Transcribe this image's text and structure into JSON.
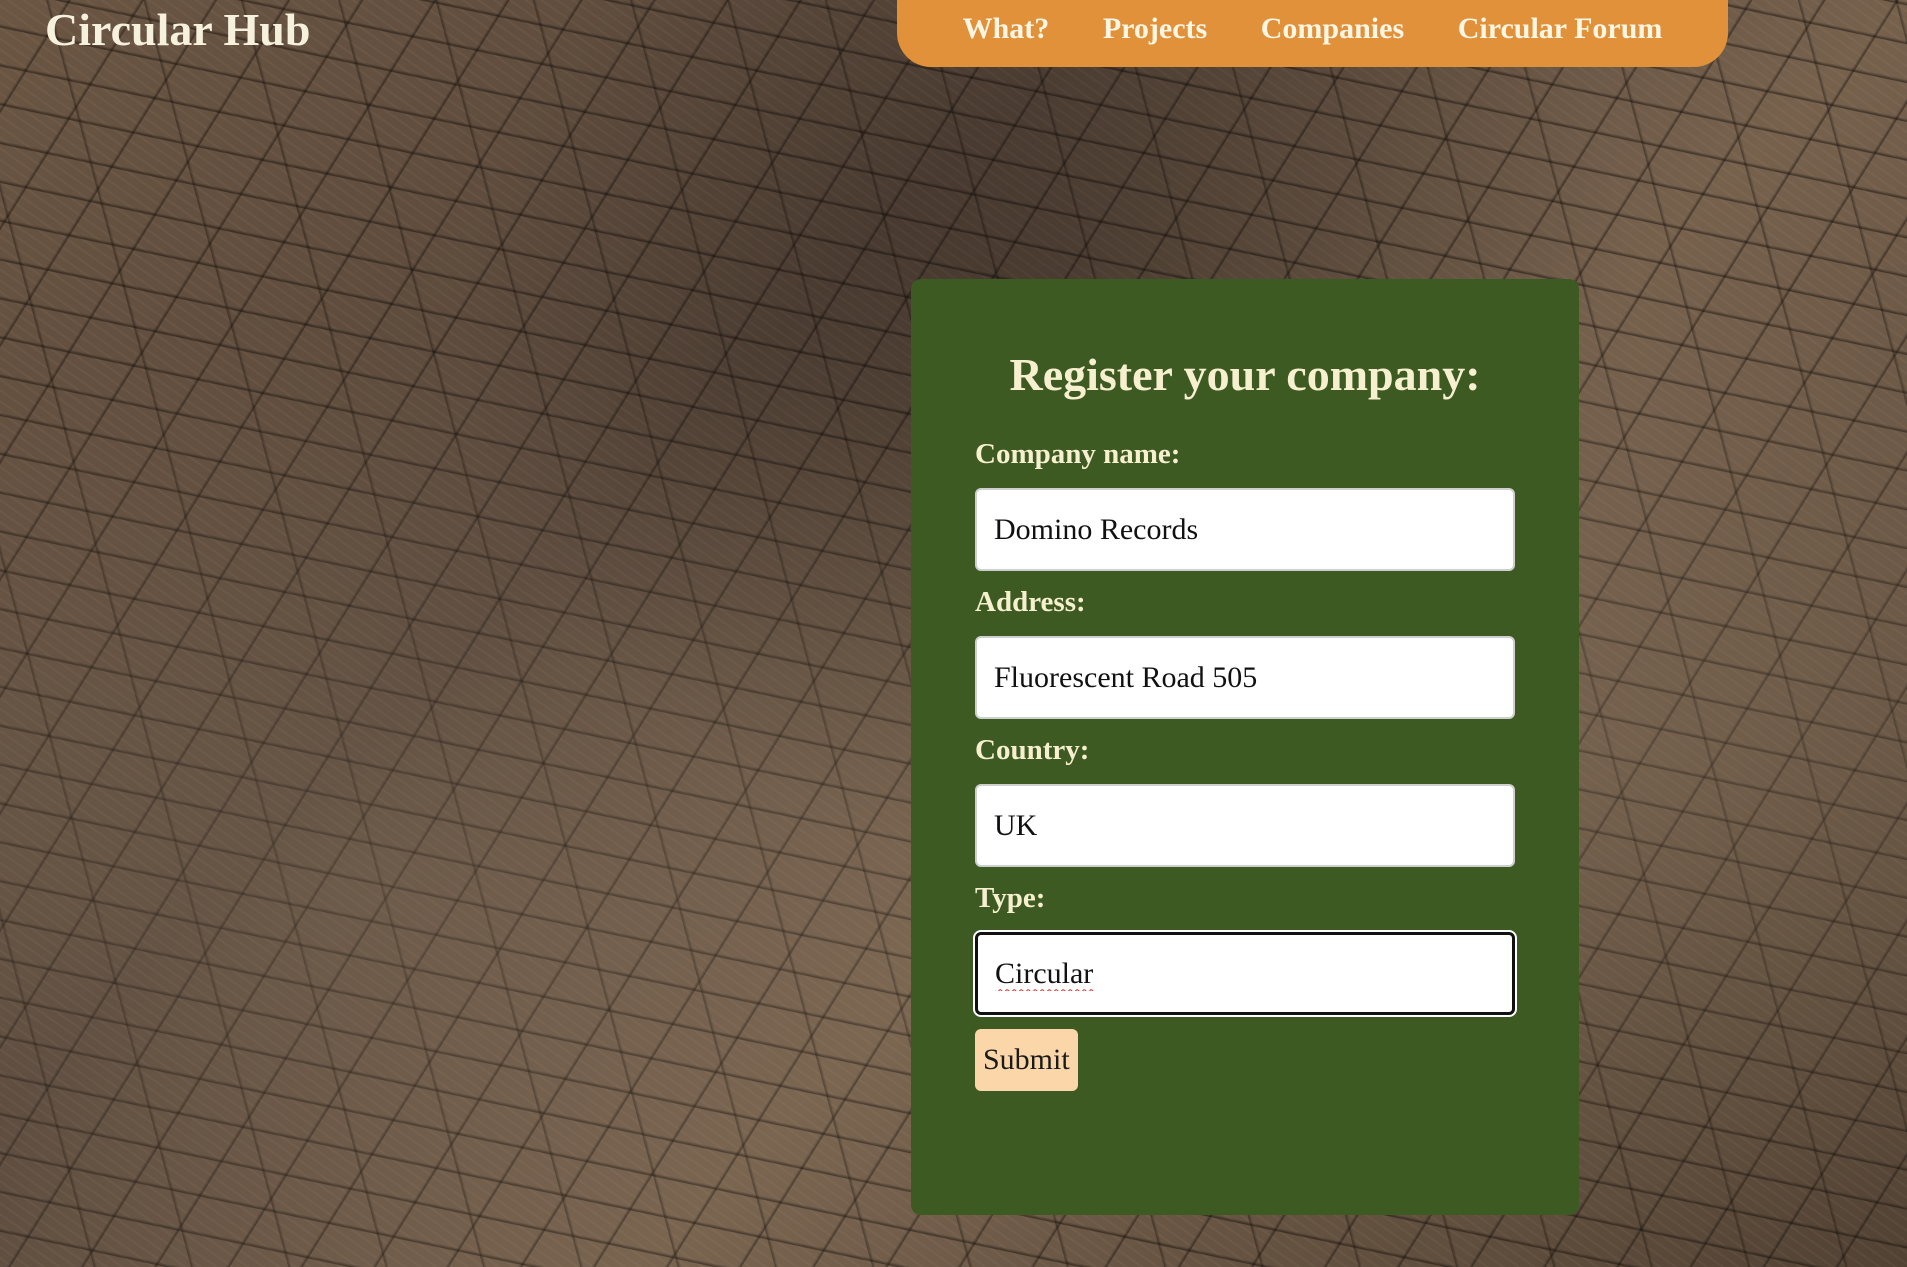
{
  "site": {
    "brand": "Circular Hub"
  },
  "nav": {
    "items": [
      {
        "label": "What?"
      },
      {
        "label": "Projects"
      },
      {
        "label": "Companies"
      },
      {
        "label": "Circular Forum"
      }
    ]
  },
  "form": {
    "title": "Register your company:",
    "fields": [
      {
        "label": "Company name:",
        "value": "Domino Records"
      },
      {
        "label": "Address:",
        "value": "Fluorescent Road 505"
      },
      {
        "label": "Country:",
        "value": "UK"
      },
      {
        "label": "Type:",
        "value": "Circular"
      }
    ],
    "submit_label": "Submit"
  },
  "colors": {
    "nav_background": "#e0913a",
    "card_background": "#3e5a23",
    "submit_background": "#fbd6a8",
    "text_light": "#f7f0cf"
  }
}
